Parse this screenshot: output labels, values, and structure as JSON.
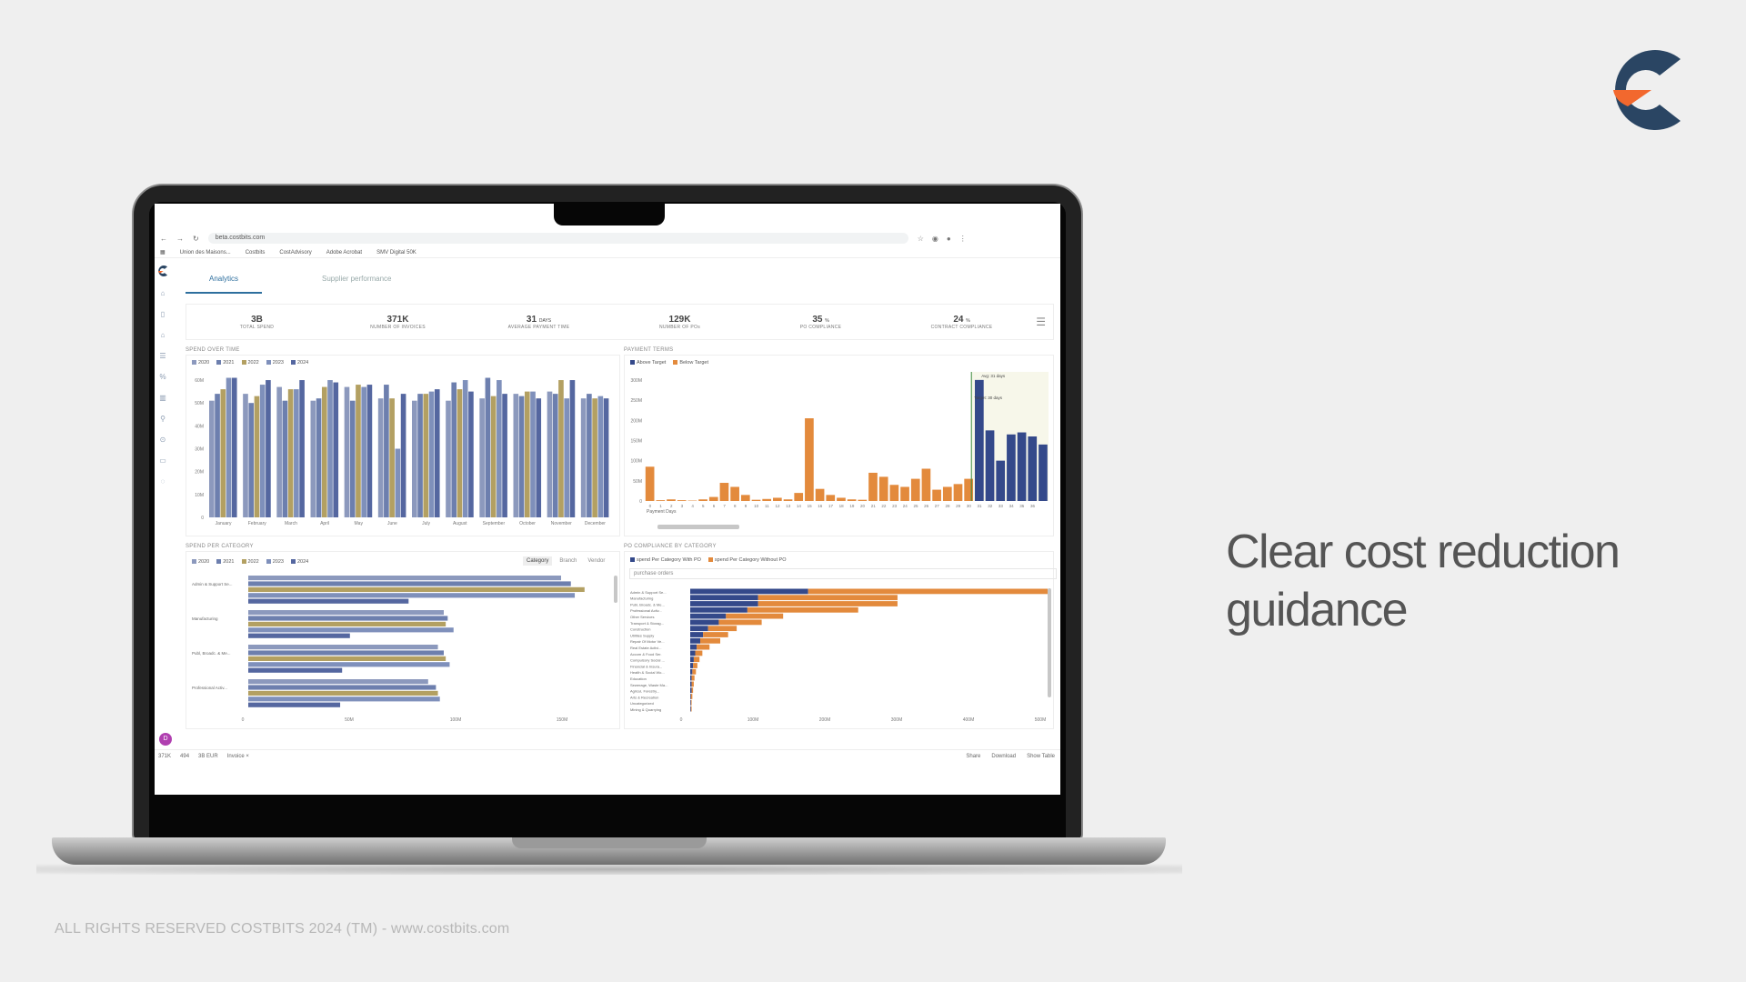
{
  "brand": {
    "colors": {
      "navy": "#2a4563",
      "orange": "#f2682e"
    }
  },
  "headline": "Clear cost reduction guidance",
  "footer": "ALL RIGHTS RESERVED COSTBITS 2024 (TM) - www.costbits.com",
  "browser": {
    "url": "beta.costbits.com",
    "bookmarks": [
      "Union des Maisons...",
      "Costbits",
      "CostAdvisory",
      "Adobe Acrobat",
      "SMV Digital 50K"
    ]
  },
  "app": {
    "tabs": [
      "Analytics",
      "Supplier performance"
    ],
    "kpis": [
      {
        "value": "3B",
        "unit": "",
        "label": "TOTAL SPEND"
      },
      {
        "value": "371K",
        "unit": "",
        "label": "NUMBER OF INVOICES"
      },
      {
        "value": "31",
        "unit": "DAYS",
        "label": "AVERAGE PAYMENT TIME"
      },
      {
        "value": "129K",
        "unit": "",
        "label": "NUMBER OF POs"
      },
      {
        "value": "35",
        "unit": "%",
        "label": "PO COMPLIANCE"
      },
      {
        "value": "24",
        "unit": "%",
        "label": "CONTRACT COMPLIANCE"
      }
    ],
    "panels": {
      "spend_over_time": "SPEND OVER TIME",
      "payment_terms": "PAYMENT TERMS",
      "spend_per_category": "SPEND PER CATEGORY",
      "po_compliance": "PO COMPLIANCE BY CATEGORY"
    },
    "segmented": [
      "Category",
      "Branch",
      "Vendor"
    ],
    "dropdown_value": "purchase orders",
    "avatar": "D",
    "status_left": [
      "371K",
      "494",
      "3B EUR",
      "Invoice ×"
    ],
    "status_right": [
      "Share",
      "Download",
      "Show Table"
    ]
  },
  "chart_data": [
    {
      "type": "bar",
      "title": "SPEND OVER TIME",
      "categories": [
        "January",
        "February",
        "March",
        "April",
        "May",
        "June",
        "July",
        "August",
        "September",
        "October",
        "November",
        "December"
      ],
      "series": [
        {
          "name": "2020",
          "color": "#8c99bd",
          "values": [
            51,
            54,
            57,
            51,
            57,
            52,
            51,
            51,
            52,
            54,
            55,
            52
          ]
        },
        {
          "name": "2021",
          "color": "#6d7fae",
          "values": [
            54,
            50,
            51,
            52,
            51,
            58,
            54,
            59,
            61,
            53,
            54,
            54
          ]
        },
        {
          "name": "2022",
          "color": "#b3a062",
          "values": [
            56,
            53,
            56,
            57,
            58,
            52,
            54,
            56,
            53,
            55,
            60,
            52
          ]
        },
        {
          "name": "2023",
          "color": "#7f90bb",
          "values": [
            61,
            58,
            56,
            60,
            57,
            30,
            55,
            60,
            60,
            55,
            52,
            53
          ]
        },
        {
          "name": "2024",
          "color": "#5567a0",
          "values": [
            61,
            60,
            60,
            59,
            58,
            54,
            56,
            55,
            54,
            52,
            60,
            52
          ]
        }
      ],
      "yticks": [
        "0",
        "10M",
        "20M",
        "30M",
        "40M",
        "50M",
        "60M"
      ],
      "ylim": [
        0,
        62
      ]
    },
    {
      "type": "bar",
      "title": "PAYMENT TERMS",
      "xlabel": "Payment Days",
      "series": [
        {
          "name": "Above Target",
          "color": "#34498a"
        },
        {
          "name": "Below Target",
          "color": "#e38a3c"
        }
      ],
      "x": [
        "0",
        "1",
        "2",
        "3",
        "4",
        "5",
        "6",
        "7",
        "8",
        "9",
        "10",
        "11",
        "12",
        "13",
        "14",
        "15",
        "16",
        "17",
        "18",
        "19",
        "20",
        "21",
        "22",
        "23",
        "24",
        "25",
        "26",
        "27",
        "28",
        "29",
        "30",
        "31",
        "32",
        "33",
        "34",
        "35",
        "36"
      ],
      "values": [
        85,
        2,
        4,
        2,
        1,
        4,
        10,
        45,
        35,
        15,
        3,
        5,
        8,
        4,
        20,
        205,
        30,
        15,
        8,
        4,
        3,
        70,
        60,
        40,
        35,
        55,
        80,
        28,
        35,
        42,
        55,
        300,
        175,
        100,
        165,
        170,
        160,
        140
      ],
      "yticks": [
        "0",
        "50M",
        "100M",
        "150M",
        "200M",
        "250M",
        "300M"
      ],
      "ylim": [
        0,
        320
      ],
      "annotations": [
        "Avg: 31 days",
        "Target: 30 days"
      ]
    },
    {
      "type": "bar",
      "title": "SPEND PER CATEGORY",
      "categories": [
        "Admin & Support Se...",
        "Manufacturing",
        "Publ, Broadc. & Me...",
        "Professional Activ..."
      ],
      "series": [
        {
          "name": "2020",
          "color": "#8c99bd",
          "values": [
            160,
            100,
            97,
            92
          ]
        },
        {
          "name": "2021",
          "color": "#6d7fae",
          "values": [
            165,
            102,
            100,
            96
          ]
        },
        {
          "name": "2022",
          "color": "#b3a062",
          "values": [
            172,
            101,
            101,
            97
          ]
        },
        {
          "name": "2023",
          "color": "#7f90bb",
          "values": [
            167,
            105,
            103,
            98
          ]
        },
        {
          "name": "2024",
          "color": "#5567a0",
          "values": [
            82,
            52,
            48,
            47
          ]
        }
      ],
      "xticks": [
        "0",
        "50M",
        "100M",
        "150M"
      ],
      "xlim": [
        0,
        180
      ]
    },
    {
      "type": "bar",
      "title": "PO COMPLIANCE BY CATEGORY",
      "categories": [
        "Admin & Support Se...",
        "Manufacturing",
        "Publ, Broadc. & Me...",
        "Professional Activ...",
        "Other Services",
        "Transport & Storag...",
        "Construction",
        "Utilities Supply",
        "Repair Of Motor Ve...",
        "Real Estate Activi...",
        "Accom & Food Ser.",
        "Compulsory Social ...",
        "Financial & Insura...",
        "Health & Social Wo...",
        "Education",
        "Sewerage, Waste Ma...",
        "Agricul, Forestry...",
        "Arts & Recreation",
        "Uncategorized",
        "Mining & Quarrying"
      ],
      "series": [
        {
          "name": "spend Per Category With PO",
          "color": "#34498a",
          "values": [
            165,
            95,
            95,
            80,
            50,
            40,
            25,
            18,
            14,
            9,
            7,
            5,
            4,
            3,
            2,
            2,
            2,
            1,
            1,
            1
          ]
        },
        {
          "name": "spend Per Category Without PO",
          "color": "#e38a3c",
          "values": [
            335,
            195,
            195,
            155,
            80,
            60,
            40,
            35,
            28,
            18,
            10,
            8,
            6,
            5,
            4,
            3,
            2,
            2,
            1,
            1
          ]
        }
      ],
      "xticks": [
        "0",
        "100M",
        "200M",
        "300M",
        "400M",
        "500M"
      ],
      "xlim": [
        0,
        500
      ]
    }
  ]
}
